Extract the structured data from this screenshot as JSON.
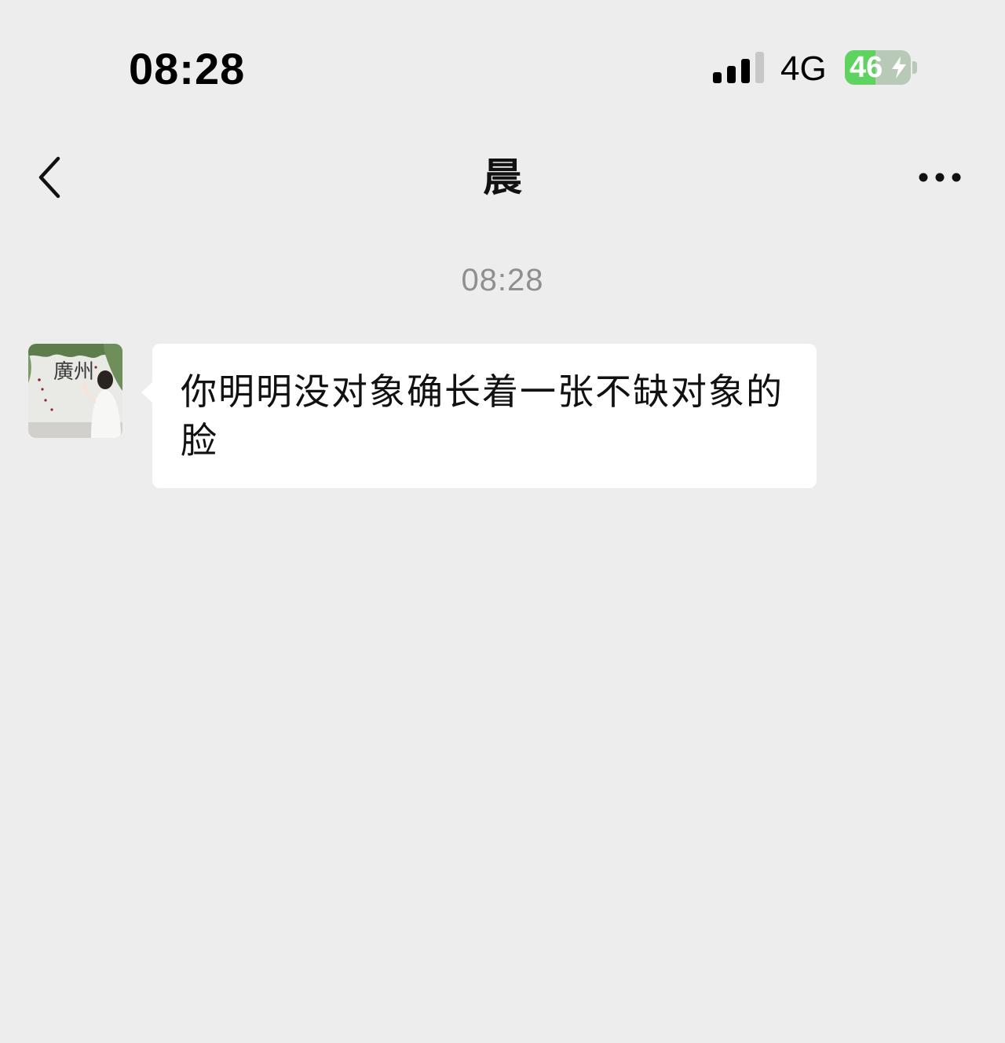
{
  "status_bar": {
    "time": "08:28",
    "network": "4G",
    "battery_level": 46,
    "battery_text": "46",
    "battery_color": "#5fd35f",
    "signal_icon": "cellular-signal-icon",
    "charging_icon": "charging-bolt-icon"
  },
  "nav": {
    "back_icon": "chevron-left-icon",
    "title": "晨",
    "more_icon": "more-dots-icon"
  },
  "chat": {
    "timestamp": "08:28",
    "messages": [
      {
        "sender": "contact",
        "avatar_caption": "廣州",
        "text": "你明明没对象确长着一张不缺对象的脸"
      }
    ]
  },
  "colors": {
    "background": "#ededed",
    "bubble": "#ffffff",
    "timestamp": "#8f8f8f"
  }
}
